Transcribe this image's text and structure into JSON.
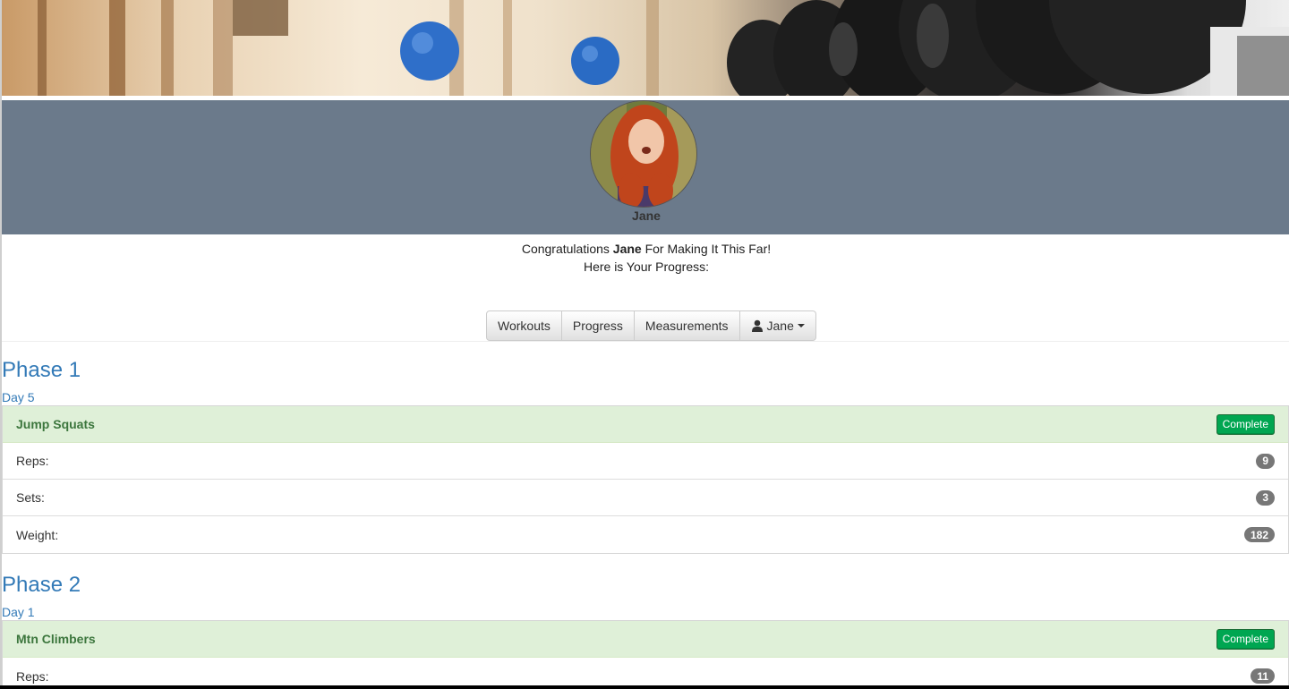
{
  "profile": {
    "name": "Jane"
  },
  "greeting": {
    "prefix": "Congratulations ",
    "name": "Jane",
    "suffix": " For Making It This Far!",
    "line2": "Here is Your Progress:"
  },
  "nav": {
    "items": [
      {
        "label": "Workouts"
      },
      {
        "label": "Progress"
      },
      {
        "label": "Measurements"
      },
      {
        "label": "Jane",
        "icon": "user-icon",
        "dropdown": true
      }
    ]
  },
  "phases": [
    {
      "title": "Phase 1",
      "day": "Day 5",
      "exercise": "Jump Squats",
      "status": "Complete",
      "rows": [
        {
          "label": "Reps:",
          "value": "9"
        },
        {
          "label": "Sets:",
          "value": "3"
        },
        {
          "label": "Weight:",
          "value": "182"
        }
      ]
    },
    {
      "title": "Phase 2",
      "day": "Day 1",
      "exercise": "Mtn Climbers",
      "status": "Complete",
      "rows": [
        {
          "label": "Reps:",
          "value": "11"
        }
      ]
    }
  ],
  "colors": {
    "profile_band": "#6b7a8b",
    "link_blue": "#337ab7",
    "success_bg": "#dff0d8",
    "complete_btn": "#00a651",
    "badge": "#777777"
  }
}
